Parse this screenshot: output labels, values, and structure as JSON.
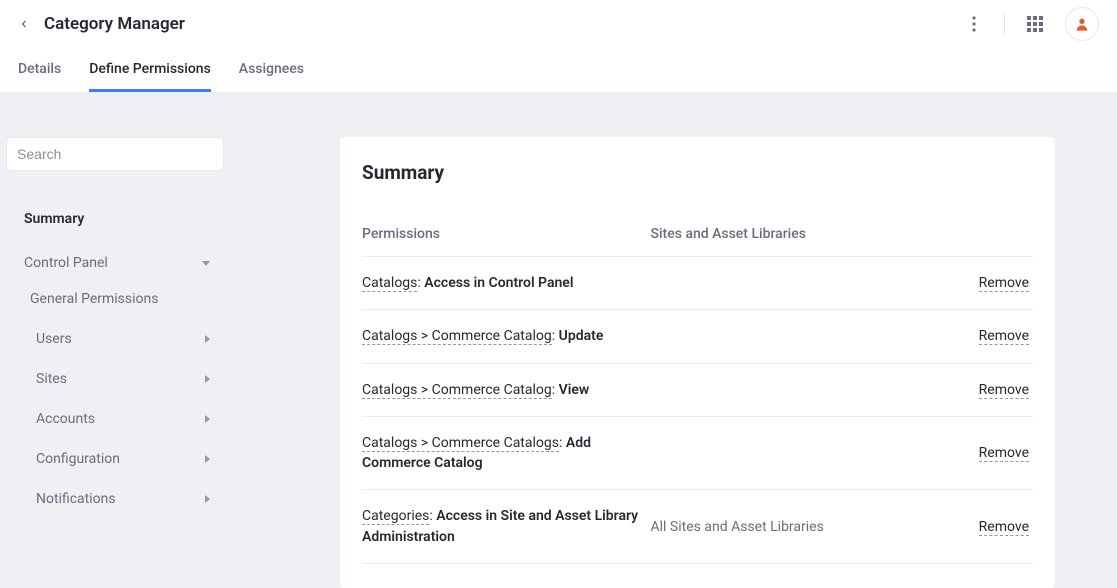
{
  "header": {
    "title": "Category Manager"
  },
  "tabs": [
    {
      "label": "Details",
      "active": false
    },
    {
      "label": "Define Permissions",
      "active": true
    },
    {
      "label": "Assignees",
      "active": false
    }
  ],
  "search": {
    "placeholder": "Search"
  },
  "sidebar": {
    "summary_label": "Summary",
    "control_panel_label": "Control Panel",
    "general_permissions_label": "General Permissions",
    "items": [
      {
        "label": "Users"
      },
      {
        "label": "Sites"
      },
      {
        "label": "Accounts"
      },
      {
        "label": "Configuration"
      },
      {
        "label": "Notifications"
      }
    ]
  },
  "summary": {
    "title": "Summary",
    "th_permissions": "Permissions",
    "th_sites": "Sites and Asset Libraries",
    "remove_label": "Remove",
    "rows": [
      {
        "path": "Catalogs",
        "action": "Access in Control Panel",
        "sites": ""
      },
      {
        "path": "Catalogs > Commerce Catalog",
        "action": "Update",
        "sites": ""
      },
      {
        "path": "Catalogs > Commerce Catalog",
        "action": "View",
        "sites": ""
      },
      {
        "path": "Catalogs > Commerce Catalogs",
        "action": "Add Commerce Catalog",
        "sites": ""
      },
      {
        "path": "Categories",
        "action": "Access in Site and Asset Library Administration",
        "sites": "All Sites and Asset Libraries"
      }
    ]
  }
}
